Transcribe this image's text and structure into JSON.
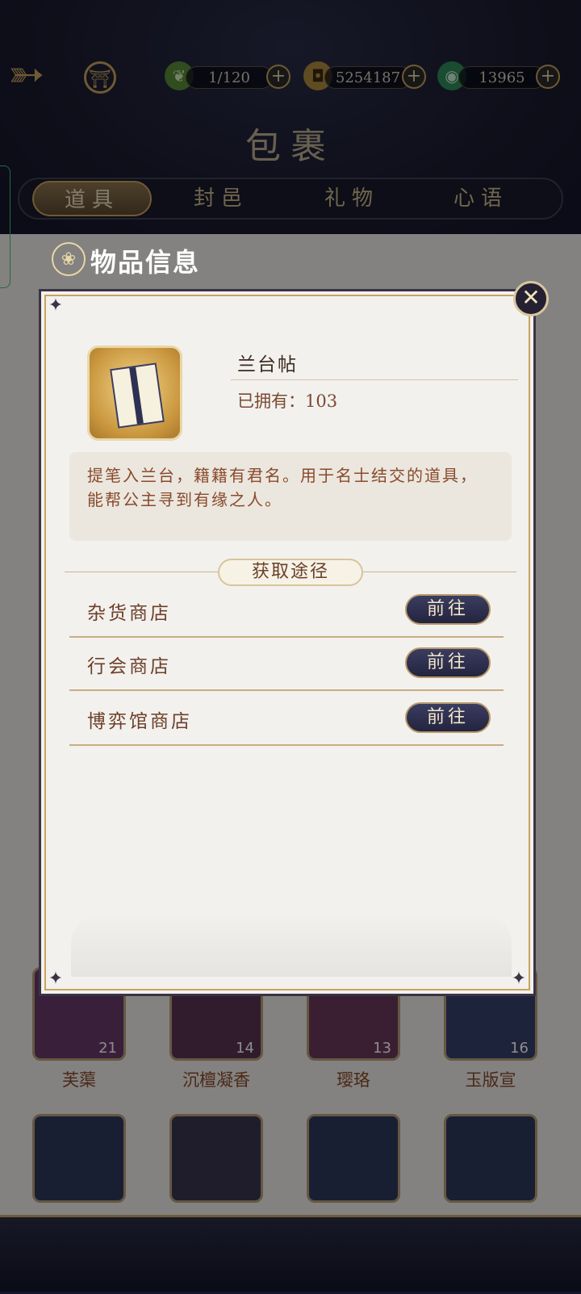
{
  "header": {
    "back_icon": "back-arrow-icon",
    "home_icon": "pavilion-icon",
    "resources": [
      {
        "icon": "leaf-icon",
        "value": "1/120"
      },
      {
        "icon": "coin-icon",
        "value": "5254187"
      },
      {
        "icon": "jade-icon",
        "value": "13965"
      }
    ],
    "plus": "+"
  },
  "page_title": "包裹",
  "tabs": [
    "道具",
    "封邑",
    "礼物",
    "心语"
  ],
  "active_tab": 0,
  "background_items": [
    {
      "name": "芙蕖",
      "count": "21"
    },
    {
      "name": "沉檀凝香",
      "count": "14"
    },
    {
      "name": "璎珞",
      "count": "13"
    },
    {
      "name": "玉版宣",
      "count": "16"
    }
  ],
  "modal": {
    "header_title": "物品信息",
    "close_icon": "close-x-icon",
    "item": {
      "name": "兰台帖",
      "owned": "已拥有：103",
      "description": "提笔入兰台，籍籍有君名。用于名士结交的道具，能帮公主寻到有缘之人。"
    },
    "section_title": "获取途径",
    "sources": [
      {
        "label": "杂货商店",
        "button": "前往"
      },
      {
        "label": "行会商店",
        "button": "前往"
      },
      {
        "label": "博弈馆商店",
        "button": "前往"
      }
    ]
  },
  "colors": {
    "gold": "#c9a45e",
    "modal_bg": "#f3f1ee",
    "text_brown": "#8a4a2c",
    "button_navy": "#2b2d4a"
  }
}
